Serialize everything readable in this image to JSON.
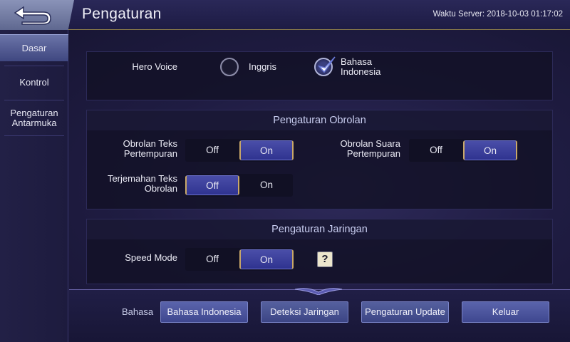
{
  "header": {
    "title": "Pengaturan",
    "server_time_label": "Waktu Server: 2018-10-03 01:17:02"
  },
  "sidebar": {
    "items": [
      {
        "label": "Dasar",
        "active": true
      },
      {
        "label": "Kontrol",
        "active": false
      },
      {
        "label": "Pengaturan Antarmuka",
        "active": false
      }
    ]
  },
  "hero_voice": {
    "label": "Hero Voice",
    "options": [
      {
        "label": "Inggris",
        "checked": false
      },
      {
        "label": "Bahasa Indonesia",
        "checked": true
      }
    ]
  },
  "chat_settings": {
    "title": "Pengaturan Obrolan",
    "text_chat_battle": {
      "label": "Obrolan Teks Pertempuran",
      "off": "Off",
      "on": "On",
      "value": "On"
    },
    "voice_chat_battle": {
      "label": "Obrolan Suara Pertempuran",
      "off": "Off",
      "on": "On",
      "value": "On"
    },
    "chat_translation": {
      "label": "Terjemahan Teks Obrolan",
      "off": "Off",
      "on": "On",
      "value": "Off"
    }
  },
  "network_settings": {
    "title": "Pengaturan Jaringan",
    "speed_mode": {
      "label": "Speed Mode",
      "off": "Off",
      "on": "On",
      "value": "On"
    },
    "help_icon": "?"
  },
  "bottom": {
    "language_label": "Bahasa",
    "language_button": "Bahasa Indonesia",
    "network_detect_button": "Deteksi Jaringan",
    "update_settings_button": "Pengaturan Update",
    "exit_button": "Keluar"
  },
  "colors": {
    "accent": "#3f4790",
    "gold": "#c9a868",
    "panel_bg": "#121126"
  }
}
